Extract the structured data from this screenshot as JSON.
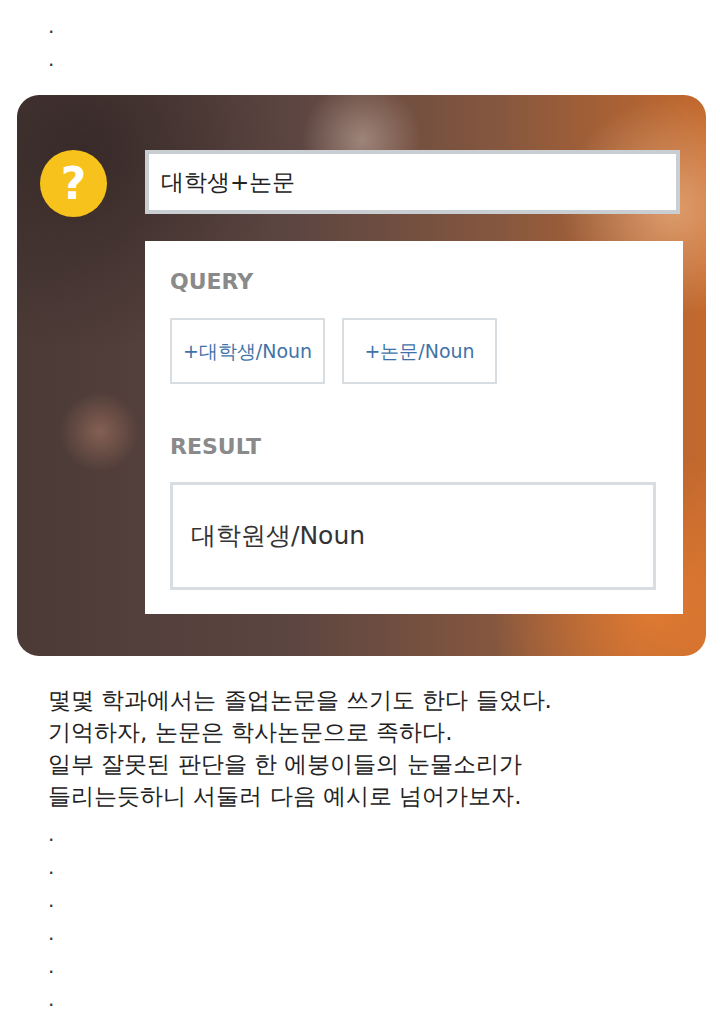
{
  "top_dots": [
    ".",
    "."
  ],
  "card": {
    "icon": "?",
    "input": "대학생+논문",
    "query_label": "QUERY",
    "query_tokens": [
      "+대학생/Noun",
      "+논문/Noun"
    ],
    "result_label": "RESULT",
    "result": "대학원생/Noun"
  },
  "paragraph": [
    "몇몇 학과에서는 졸업논문을 쓰기도 한다 들었다.",
    "기억하자, 논문은 학사논문으로 족하다.",
    "일부 잘못된 판단을 한 에붕이들의 눈물소리가",
    "들리는듯하니 서둘러 다음 예시로 넘어가보자."
  ],
  "bottom_dots": [
    ".",
    ".",
    ".",
    ".",
    ".",
    "."
  ]
}
